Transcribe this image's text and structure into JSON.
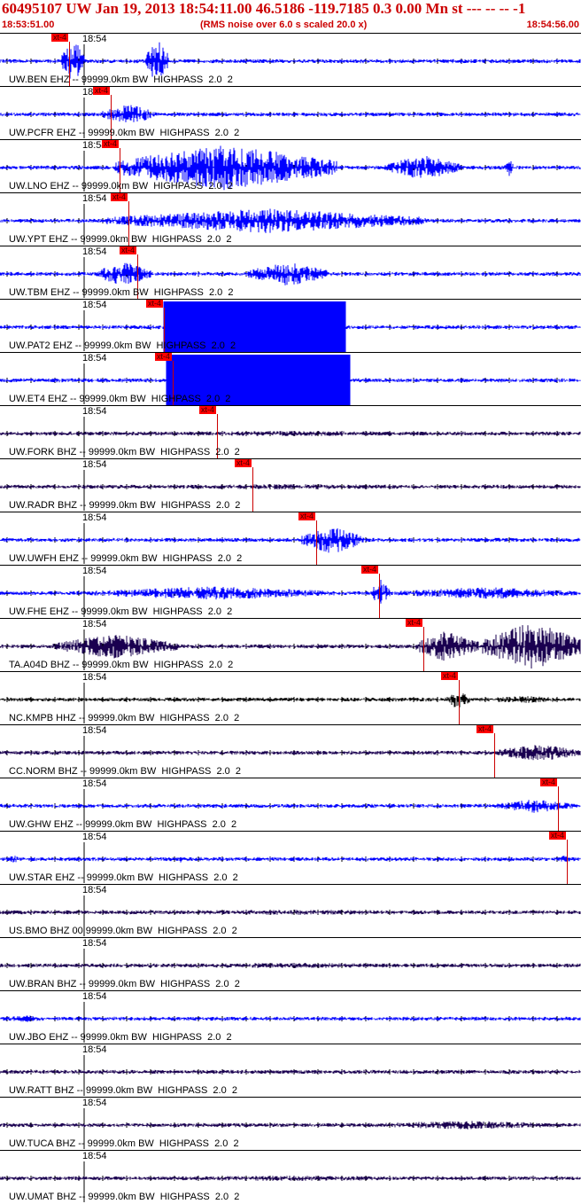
{
  "header": {
    "title": "60495107 UW Jan 19, 2013 18:54:11.00   46.5186 -119.7185  0.3 0.00 Mn st --- -- --  -1",
    "start_time": "18:53:51.00",
    "rms_note": "(RMS noise over 6.0 s scaled 20.0 x)",
    "end_time": "18:54:56.00"
  },
  "colors": {
    "header_text": "#cc0000",
    "pick_flag": "#ff0000",
    "blue_trace": "#0000ff",
    "dark_trace": "#1a0050",
    "black_trace": "#000000"
  },
  "minute_label": "18:54",
  "traces": [
    {
      "label": "UW.BEN EHZ -- 99999.0km BW  HIGHPASS  2.0  2",
      "pick": "xt-4",
      "color": "#0000ff"
    },
    {
      "label": "UW.PCFR EHZ -- 99999.0km BW  HIGHPASS  2.0  2",
      "pick": "xt-4",
      "color": "#0000ff"
    },
    {
      "label": "UW.LNO EHZ -- 99999.0km BW  HIGHPASS  2.0  2",
      "pick": "xt-4",
      "color": "#0000ff"
    },
    {
      "label": "UW.YPT EHZ -- 99999.0km BW  HIGHPASS  2.0  2",
      "pick": "xt-4",
      "color": "#0000ff"
    },
    {
      "label": "UW.TBM EHZ -- 99999.0km BW  HIGHPASS  2.0  2",
      "pick": "xt-4",
      "color": "#0000ff"
    },
    {
      "label": "UW.PAT2 EHZ -- 99999.0km BW  HIGHPASS  2.0  2",
      "pick": "xt-4",
      "color": "#0000ff"
    },
    {
      "label": "UW.ET4 EHZ -- 99999.0km BW  HIGHPASS  2.0  2",
      "pick": "xt-4",
      "color": "#0000ff"
    },
    {
      "label": "UW.FORK BHZ -- 99999.0km BW  HIGHPASS  2.0  2",
      "pick": "xt-4",
      "color": "#1a0050"
    },
    {
      "label": "UW.RADR BHZ -- 99999.0km BW  HIGHPASS  2.0  2",
      "pick": "xt-4",
      "color": "#1a0050"
    },
    {
      "label": "UW.UWFH EHZ -- 99999.0km BW  HIGHPASS  2.0  2",
      "pick": "xt-4",
      "color": "#0000ff"
    },
    {
      "label": "UW.FHE EHZ -- 99999.0km BW  HIGHPASS  2.0  2",
      "pick": "xt-4",
      "color": "#0000ff"
    },
    {
      "label": "TA.A04D BHZ -- 99999.0km BW  HIGHPASS  2.0  2",
      "pick": "xt-4",
      "color": "#1a0050"
    },
    {
      "label": "NC.KMPB HHZ -- 99999.0km BW  HIGHPASS  2.0  2",
      "pick": "xt-4",
      "color": "#000000"
    },
    {
      "label": "CC.NORM BHZ -- 99999.0km BW  HIGHPASS  2.0  2",
      "pick": "xt-4",
      "color": "#1a0050"
    },
    {
      "label": "UW.GHW EHZ -- 99999.0km BW  HIGHPASS  2.0  2",
      "pick": "xt-4",
      "color": "#0000ff"
    },
    {
      "label": "UW.STAR EHZ -- 99999.0km BW  HIGHPASS  2.0  2",
      "pick": "xt-4",
      "color": "#0000ff"
    },
    {
      "label": "US.BMO BHZ 00 99999.0km BW  HIGHPASS  2.0  2",
      "pick": "",
      "color": "#1a0050"
    },
    {
      "label": "UW.BRAN BHZ -- 99999.0km BW  HIGHPASS  2.0  2",
      "pick": "",
      "color": "#1a0050"
    },
    {
      "label": "UW.JBO EHZ -- 99999.0km BW  HIGHPASS  2.0  2",
      "pick": "",
      "color": "#0000ff"
    },
    {
      "label": "UW.RATT BHZ -- 99999.0km BW  HIGHPASS  2.0  2",
      "pick": "",
      "color": "#1a0050"
    },
    {
      "label": "UW.TUCA BHZ -- 99999.0km BW  HIGHPASS  2.0  2",
      "pick": "",
      "color": "#1a0050"
    },
    {
      "label": "UW.UMAT BHZ -- 99999.0km BW  HIGHPASS  2.0  2",
      "pick": "",
      "color": "#1a0050"
    }
  ]
}
